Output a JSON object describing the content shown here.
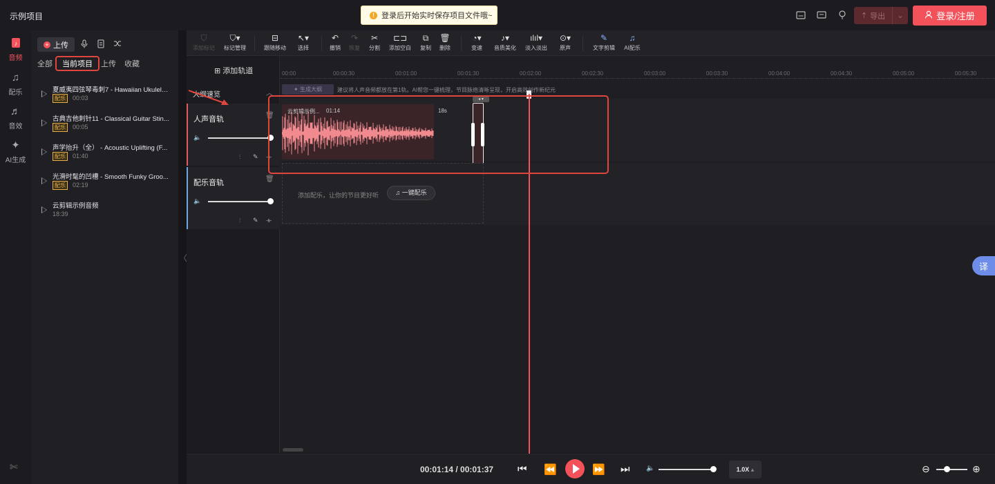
{
  "header": {
    "project_title": "示例项目",
    "toast": "登录后开始实时保存项目文件哦~",
    "toast_icon": "!",
    "export_label": "导出",
    "login_label": "登录/注册"
  },
  "rail": {
    "items": [
      {
        "label": "音频",
        "icon": "♪"
      },
      {
        "label": "配乐",
        "icon": "♫"
      },
      {
        "label": "音效",
        "icon": "♬"
      },
      {
        "label": "AI生成",
        "icon": "✦"
      }
    ]
  },
  "panel": {
    "upload_label": "上传",
    "tabs": [
      "全部",
      "当前项目",
      "上传",
      "收藏"
    ],
    "list": [
      {
        "name": "夏威夷四弦琴毒刺7 - Hawaiian Ukulele...",
        "tag": "配乐",
        "duration": "00:03"
      },
      {
        "name": "古典吉他刺针11 - Classical Guitar Stin...",
        "tag": "配乐",
        "duration": "00:05"
      },
      {
        "name": "声学抬升（全） - Acoustic Uplifting (F...",
        "tag": "配乐",
        "duration": "01:40"
      },
      {
        "name": "光滑时髦的凹槽 - Smooth Funky Groo...",
        "tag": "配乐",
        "duration": "02:19"
      },
      {
        "name": "云剪辑示例音频",
        "tag": "",
        "duration": "18:39"
      }
    ]
  },
  "toolbar": {
    "tools": [
      "添加标记",
      "标记管理",
      "跟随移动",
      "选择",
      "撤销",
      "恢复",
      "分割",
      "添加空白",
      "复制",
      "删除",
      "变速",
      "音质美化",
      "淡入淡出",
      "原声",
      "文字剪辑",
      "AI配乐"
    ]
  },
  "tracks": {
    "add_track": "添加轨道",
    "outline": "大纲速览",
    "voice_track": "人声音轨",
    "music_track": "配乐音轨"
  },
  "timeline": {
    "ticks": [
      "00:00",
      "00:00:30",
      "00:01:00",
      "00:01:30",
      "00:02:00",
      "00:02:30",
      "00:03:00",
      "00:03:30",
      "00:04:00",
      "00:04:30",
      "00:05:00",
      "00:05:30"
    ],
    "gen_outline": "生成大纲",
    "ai_hint": "建议将人声音频都放在第1轨。AI帮您一键梳理，节目脉络清晰呈现，开启高效创作新纪元",
    "clip_name": "云剪辑示例...",
    "clip_time": "01:14",
    "clip_len": "18s",
    "music_hint": "添加配乐，让你的节目更好听",
    "onekey_music": "一键配乐"
  },
  "player": {
    "timecode": "00:01:14 / 00:01:37",
    "speed": "1.0X",
    "volume": 0.97,
    "zoom": 0.3
  },
  "side": {
    "translate": "译"
  },
  "colors": {
    "accent": "#f4525a",
    "annotation": "#e0463e",
    "waveform": "#f08a8f"
  }
}
